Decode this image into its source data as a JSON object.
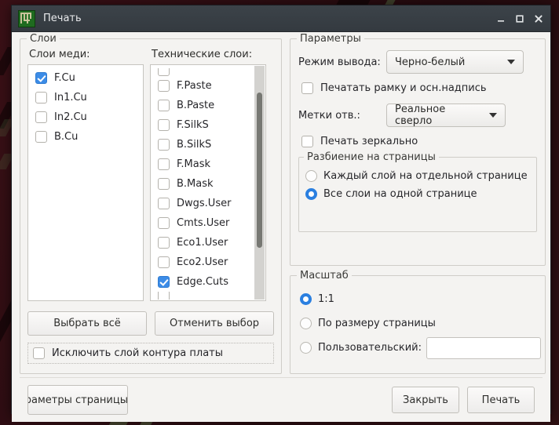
{
  "window": {
    "title": "Печать",
    "icon": "kicad-pcb-icon",
    "controls": {
      "minimize": "minimize-icon",
      "maximize": "maximize-icon",
      "close": "close-icon"
    }
  },
  "layers": {
    "legend": "Слои",
    "copper": {
      "label": "Слои меди:",
      "items": [
        {
          "label": "F.Cu",
          "checked": true
        },
        {
          "label": "In1.Cu",
          "checked": false
        },
        {
          "label": "In2.Cu",
          "checked": false
        },
        {
          "label": "B.Cu",
          "checked": false
        }
      ]
    },
    "technical": {
      "label": "Технические слои:",
      "items": [
        {
          "label": "F.Paste",
          "checked": false
        },
        {
          "label": "B.Paste",
          "checked": false
        },
        {
          "label": "F.SilkS",
          "checked": false
        },
        {
          "label": "B.SilkS",
          "checked": false
        },
        {
          "label": "F.Mask",
          "checked": false
        },
        {
          "label": "B.Mask",
          "checked": false
        },
        {
          "label": "Dwgs.User",
          "checked": false
        },
        {
          "label": "Cmts.User",
          "checked": false
        },
        {
          "label": "Eco1.User",
          "checked": false
        },
        {
          "label": "Eco2.User",
          "checked": false
        },
        {
          "label": "Edge.Cuts",
          "checked": true
        }
      ]
    },
    "select_all": "Выбрать всё",
    "deselect_all": "Отменить выбор",
    "exclude_edge": {
      "label": "Исключить слой контура платы",
      "checked": false
    }
  },
  "params": {
    "legend": "Параметры",
    "mode_label": "Режим вывода:",
    "mode_value": "Черно-белый",
    "print_frame": {
      "label": "Печатать рамку и осн.надпись",
      "checked": false
    },
    "drill_label": "Метки отв.:",
    "drill_value": "Реальное сверло",
    "mirror": {
      "label": "Печать зеркально",
      "checked": false
    },
    "pagination": {
      "legend": "Разбиение на страницы",
      "options": [
        {
          "label": "Каждый слой на отдельной странице",
          "selected": false
        },
        {
          "label": "Все слои на одной странице",
          "selected": true
        }
      ]
    }
  },
  "scale": {
    "legend": "Масштаб",
    "options": [
      {
        "label": "1:1",
        "selected": true
      },
      {
        "label": "По размеру страницы",
        "selected": false
      },
      {
        "label": "Пользовательский:",
        "selected": false
      }
    ],
    "custom_value": "",
    "custom_placeholder": ""
  },
  "bottom": {
    "page_setup": "Параметры страницы",
    "close": "Закрыть",
    "print": "Печать"
  },
  "colors": {
    "accent": "#3c8ce7",
    "radio_accent": "#2a7fe0",
    "titlebar": "#3c4349",
    "window_bg": "#f4f3f1"
  }
}
